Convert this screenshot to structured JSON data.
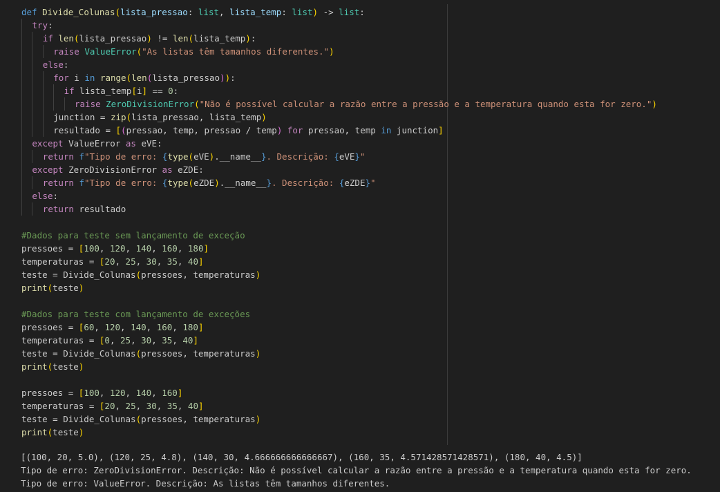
{
  "editor": {
    "code_lines": [
      {
        "indent": 0,
        "tokens": [
          [
            "kw",
            "def "
          ],
          [
            "fn",
            "Divide_Colunas"
          ],
          [
            "b1",
            "("
          ],
          [
            "var",
            "lista_pressao"
          ],
          [
            "pl",
            ": "
          ],
          [
            "cls",
            "list"
          ],
          [
            "pl",
            ", "
          ],
          [
            "var",
            "lista_temp"
          ],
          [
            "pl",
            ": "
          ],
          [
            "cls",
            "list"
          ],
          [
            "b1",
            ")"
          ],
          [
            "pl",
            " -> "
          ],
          [
            "cls",
            "list"
          ],
          [
            "pl",
            ":"
          ]
        ]
      },
      {
        "indent": 1,
        "tokens": [
          [
            "ctl",
            "try"
          ],
          [
            "pl",
            ":"
          ]
        ]
      },
      {
        "indent": 2,
        "tokens": [
          [
            "ctl",
            "if "
          ],
          [
            "fn",
            "len"
          ],
          [
            "b1",
            "("
          ],
          [
            "pl",
            "lista_pressao"
          ],
          [
            "b1",
            ")"
          ],
          [
            "pl",
            " != "
          ],
          [
            "fn",
            "len"
          ],
          [
            "b1",
            "("
          ],
          [
            "pl",
            "lista_temp"
          ],
          [
            "b1",
            ")"
          ],
          [
            "pl",
            ":"
          ]
        ]
      },
      {
        "indent": 3,
        "tokens": [
          [
            "ctl",
            "raise "
          ],
          [
            "cls",
            "ValueError"
          ],
          [
            "b1",
            "("
          ],
          [
            "str",
            "\"As listas têm tamanhos diferentes.\""
          ],
          [
            "b1",
            ")"
          ]
        ]
      },
      {
        "indent": 2,
        "tokens": [
          [
            "ctl",
            "else"
          ],
          [
            "pl",
            ":"
          ]
        ]
      },
      {
        "indent": 3,
        "tokens": [
          [
            "ctl",
            "for "
          ],
          [
            "pl",
            "i "
          ],
          [
            "kw",
            "in "
          ],
          [
            "fn",
            "range"
          ],
          [
            "b1",
            "("
          ],
          [
            "fn",
            "len"
          ],
          [
            "b2",
            "("
          ],
          [
            "pl",
            "lista_pressao"
          ],
          [
            "b2",
            ")"
          ],
          [
            "b1",
            ")"
          ],
          [
            "pl",
            ":"
          ]
        ]
      },
      {
        "indent": 4,
        "tokens": [
          [
            "ctl",
            "if "
          ],
          [
            "pl",
            "lista_temp"
          ],
          [
            "b1",
            "["
          ],
          [
            "pl",
            "i"
          ],
          [
            "b1",
            "]"
          ],
          [
            "pl",
            " == "
          ],
          [
            "num",
            "0"
          ],
          [
            "pl",
            ":"
          ]
        ]
      },
      {
        "indent": 5,
        "tokens": [
          [
            "ctl",
            "raise "
          ],
          [
            "cls",
            "ZeroDivisionError"
          ],
          [
            "b1",
            "("
          ],
          [
            "str",
            "\"Não é possível calcular a razão entre a pressão e a temperatura quando esta for zero.\""
          ],
          [
            "b1",
            ")"
          ]
        ]
      },
      {
        "indent": 3,
        "tokens": [
          [
            "pl",
            "junction = "
          ],
          [
            "fn",
            "zip"
          ],
          [
            "b1",
            "("
          ],
          [
            "pl",
            "lista_pressao, lista_temp"
          ],
          [
            "b1",
            ")"
          ]
        ]
      },
      {
        "indent": 3,
        "tokens": [
          [
            "pl",
            "resultado = "
          ],
          [
            "b1",
            "["
          ],
          [
            "b2",
            "("
          ],
          [
            "pl",
            "pressao, temp, pressao / temp"
          ],
          [
            "b2",
            ")"
          ],
          [
            "pl",
            " "
          ],
          [
            "ctl",
            "for "
          ],
          [
            "pl",
            "pressao, temp "
          ],
          [
            "kw",
            "in "
          ],
          [
            "pl",
            "junction"
          ],
          [
            "b1",
            "]"
          ]
        ]
      },
      {
        "indent": 1,
        "tokens": [
          [
            "ctl",
            "except "
          ],
          [
            "pl",
            "ValueError "
          ],
          [
            "ctl",
            "as "
          ],
          [
            "pl",
            "eVE:"
          ]
        ]
      },
      {
        "indent": 2,
        "tokens": [
          [
            "ctl",
            "return "
          ],
          [
            "kw",
            "f"
          ],
          [
            "str",
            "\"Tipo de erro: "
          ],
          [
            "kw",
            "{"
          ],
          [
            "fn",
            "type"
          ],
          [
            "b1",
            "("
          ],
          [
            "pl",
            "eVE"
          ],
          [
            "b1",
            ")"
          ],
          [
            "pl",
            "."
          ],
          [
            "pl",
            "__name__"
          ],
          [
            "kw",
            "}"
          ],
          [
            "str",
            ". Descrição: "
          ],
          [
            "kw",
            "{"
          ],
          [
            "pl",
            "eVE"
          ],
          [
            "kw",
            "}"
          ],
          [
            "str",
            "\""
          ]
        ]
      },
      {
        "indent": 1,
        "tokens": [
          [
            "ctl",
            "except "
          ],
          [
            "pl",
            "ZeroDivisionError "
          ],
          [
            "ctl",
            "as "
          ],
          [
            "pl",
            "eZDE:"
          ]
        ]
      },
      {
        "indent": 2,
        "tokens": [
          [
            "ctl",
            "return "
          ],
          [
            "kw",
            "f"
          ],
          [
            "str",
            "\"Tipo de erro: "
          ],
          [
            "kw",
            "{"
          ],
          [
            "fn",
            "type"
          ],
          [
            "b1",
            "("
          ],
          [
            "pl",
            "eZDE"
          ],
          [
            "b1",
            ")"
          ],
          [
            "pl",
            "."
          ],
          [
            "pl",
            "__name__"
          ],
          [
            "kw",
            "}"
          ],
          [
            "str",
            ". Descrição: "
          ],
          [
            "kw",
            "{"
          ],
          [
            "pl",
            "eZDE"
          ],
          [
            "kw",
            "}"
          ],
          [
            "str",
            "\""
          ]
        ]
      },
      {
        "indent": 1,
        "tokens": [
          [
            "ctl",
            "else"
          ],
          [
            "pl",
            ":"
          ]
        ]
      },
      {
        "indent": 2,
        "tokens": [
          [
            "ctl",
            "return "
          ],
          [
            "pl",
            "resultado"
          ]
        ]
      },
      {
        "indent": 0,
        "tokens": []
      },
      {
        "indent": 0,
        "tokens": [
          [
            "cmt",
            "#Dados para teste sem lançamento de exceção"
          ]
        ]
      },
      {
        "indent": 0,
        "tokens": [
          [
            "pl",
            "pressoes = "
          ],
          [
            "b1",
            "["
          ],
          [
            "num",
            "100"
          ],
          [
            "pl",
            ", "
          ],
          [
            "num",
            "120"
          ],
          [
            "pl",
            ", "
          ],
          [
            "num",
            "140"
          ],
          [
            "pl",
            ", "
          ],
          [
            "num",
            "160"
          ],
          [
            "pl",
            ", "
          ],
          [
            "num",
            "180"
          ],
          [
            "b1",
            "]"
          ]
        ]
      },
      {
        "indent": 0,
        "tokens": [
          [
            "pl",
            "temperaturas = "
          ],
          [
            "b1",
            "["
          ],
          [
            "num",
            "20"
          ],
          [
            "pl",
            ", "
          ],
          [
            "num",
            "25"
          ],
          [
            "pl",
            ", "
          ],
          [
            "num",
            "30"
          ],
          [
            "pl",
            ", "
          ],
          [
            "num",
            "35"
          ],
          [
            "pl",
            ", "
          ],
          [
            "num",
            "40"
          ],
          [
            "b1",
            "]"
          ]
        ]
      },
      {
        "indent": 0,
        "tokens": [
          [
            "pl",
            "teste = Divide_Colunas"
          ],
          [
            "b1",
            "("
          ],
          [
            "pl",
            "pressoes, temperaturas"
          ],
          [
            "b1",
            ")"
          ]
        ]
      },
      {
        "indent": 0,
        "tokens": [
          [
            "fn",
            "print"
          ],
          [
            "b1",
            "("
          ],
          [
            "pl",
            "teste"
          ],
          [
            "b1",
            ")"
          ]
        ]
      },
      {
        "indent": 0,
        "tokens": []
      },
      {
        "indent": 0,
        "tokens": [
          [
            "cmt",
            "#Dados para teste com lançamento de exceções"
          ]
        ]
      },
      {
        "indent": 0,
        "tokens": [
          [
            "pl",
            "pressoes = "
          ],
          [
            "b1",
            "["
          ],
          [
            "num",
            "60"
          ],
          [
            "pl",
            ", "
          ],
          [
            "num",
            "120"
          ],
          [
            "pl",
            ", "
          ],
          [
            "num",
            "140"
          ],
          [
            "pl",
            ", "
          ],
          [
            "num",
            "160"
          ],
          [
            "pl",
            ", "
          ],
          [
            "num",
            "180"
          ],
          [
            "b1",
            "]"
          ]
        ]
      },
      {
        "indent": 0,
        "tokens": [
          [
            "pl",
            "temperaturas = "
          ],
          [
            "b1",
            "["
          ],
          [
            "num",
            "0"
          ],
          [
            "pl",
            ", "
          ],
          [
            "num",
            "25"
          ],
          [
            "pl",
            ", "
          ],
          [
            "num",
            "30"
          ],
          [
            "pl",
            ", "
          ],
          [
            "num",
            "35"
          ],
          [
            "pl",
            ", "
          ],
          [
            "num",
            "40"
          ],
          [
            "b1",
            "]"
          ]
        ]
      },
      {
        "indent": 0,
        "tokens": [
          [
            "pl",
            "teste = Divide_Colunas"
          ],
          [
            "b1",
            "("
          ],
          [
            "pl",
            "pressoes, temperaturas"
          ],
          [
            "b1",
            ")"
          ]
        ]
      },
      {
        "indent": 0,
        "tokens": [
          [
            "fn",
            "print"
          ],
          [
            "b1",
            "("
          ],
          [
            "pl",
            "teste"
          ],
          [
            "b1",
            ")"
          ]
        ]
      },
      {
        "indent": 0,
        "tokens": []
      },
      {
        "indent": 0,
        "tokens": [
          [
            "pl",
            "pressoes = "
          ],
          [
            "b1",
            "["
          ],
          [
            "num",
            "100"
          ],
          [
            "pl",
            ", "
          ],
          [
            "num",
            "120"
          ],
          [
            "pl",
            ", "
          ],
          [
            "num",
            "140"
          ],
          [
            "pl",
            ", "
          ],
          [
            "num",
            "160"
          ],
          [
            "b1",
            "]"
          ]
        ]
      },
      {
        "indent": 0,
        "tokens": [
          [
            "pl",
            "temperaturas = "
          ],
          [
            "b1",
            "["
          ],
          [
            "num",
            "20"
          ],
          [
            "pl",
            ", "
          ],
          [
            "num",
            "25"
          ],
          [
            "pl",
            ", "
          ],
          [
            "num",
            "30"
          ],
          [
            "pl",
            ", "
          ],
          [
            "num",
            "35"
          ],
          [
            "pl",
            ", "
          ],
          [
            "num",
            "40"
          ],
          [
            "b1",
            "]"
          ]
        ]
      },
      {
        "indent": 0,
        "tokens": [
          [
            "pl",
            "teste = Divide_Colunas"
          ],
          [
            "b1",
            "("
          ],
          [
            "pl",
            "pressoes, temperaturas"
          ],
          [
            "b1",
            ")"
          ]
        ]
      },
      {
        "indent": 0,
        "tokens": [
          [
            "fn",
            "print"
          ],
          [
            "b1",
            "("
          ],
          [
            "pl",
            "teste"
          ],
          [
            "b1",
            ")"
          ]
        ]
      }
    ]
  },
  "output": {
    "lines": [
      "[(100, 20, 5.0), (120, 25, 4.8), (140, 30, 4.666666666666667), (160, 35, 4.571428571428571), (180, 40, 4.5)]",
      "Tipo de erro: ZeroDivisionError. Descrição: Não é possível calcular a razão entre a pressão e a temperatura quando esta for zero.",
      "Tipo de erro: ValueError. Descrição: As listas têm tamanhos diferentes."
    ]
  },
  "colors": {
    "background": "#1f1f1f",
    "keyword": "#569cd6",
    "control": "#c586c0",
    "function": "#dcdcaa",
    "class": "#4ec9b0",
    "string": "#ce9178",
    "number": "#b5cea8",
    "comment": "#6a9955",
    "text": "#cccccc"
  }
}
